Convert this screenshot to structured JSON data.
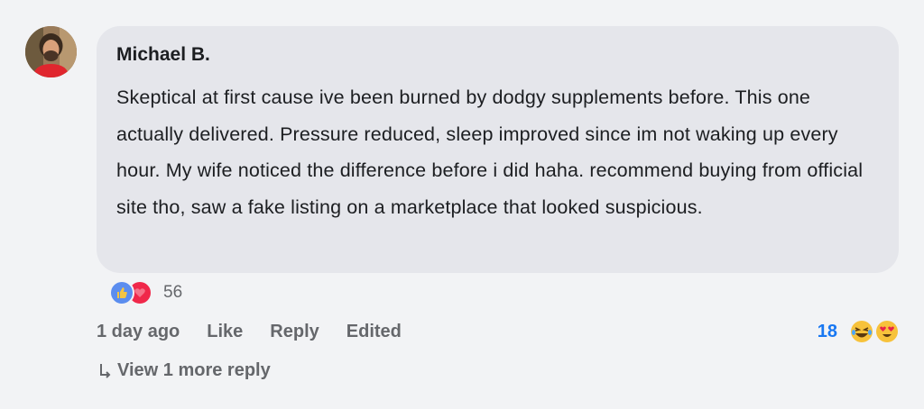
{
  "comment": {
    "author": "Michael B.",
    "text": "Skeptical at first cause ive been burned by dodgy supplements before. This one actually delivered. Pressure reduced, sleep improved since im not waking up every hour. My wife noticed the difference before i did haha. recommend buying from official site tho, saw a fake listing on a marketplace that looked suspicious.",
    "avatar_icon": "user-photo"
  },
  "reactions": {
    "icons": [
      "thumbs-up-icon",
      "heart-icon"
    ],
    "count": "56"
  },
  "actions": {
    "timestamp": "1 day ago",
    "like_label": "Like",
    "reply_label": "Reply",
    "edited_label": "Edited"
  },
  "reply_reactions": {
    "count": "18",
    "icons": [
      "laughing-emoji-icon",
      "heart-eyes-emoji-icon"
    ]
  },
  "view_more": {
    "label": "View 1 more reply"
  },
  "colors": {
    "background": "#f2f3f5",
    "bubble": "#e5e6eb",
    "text": "#1c1e21",
    "muted": "#65676b",
    "accent": "#1877f2"
  }
}
